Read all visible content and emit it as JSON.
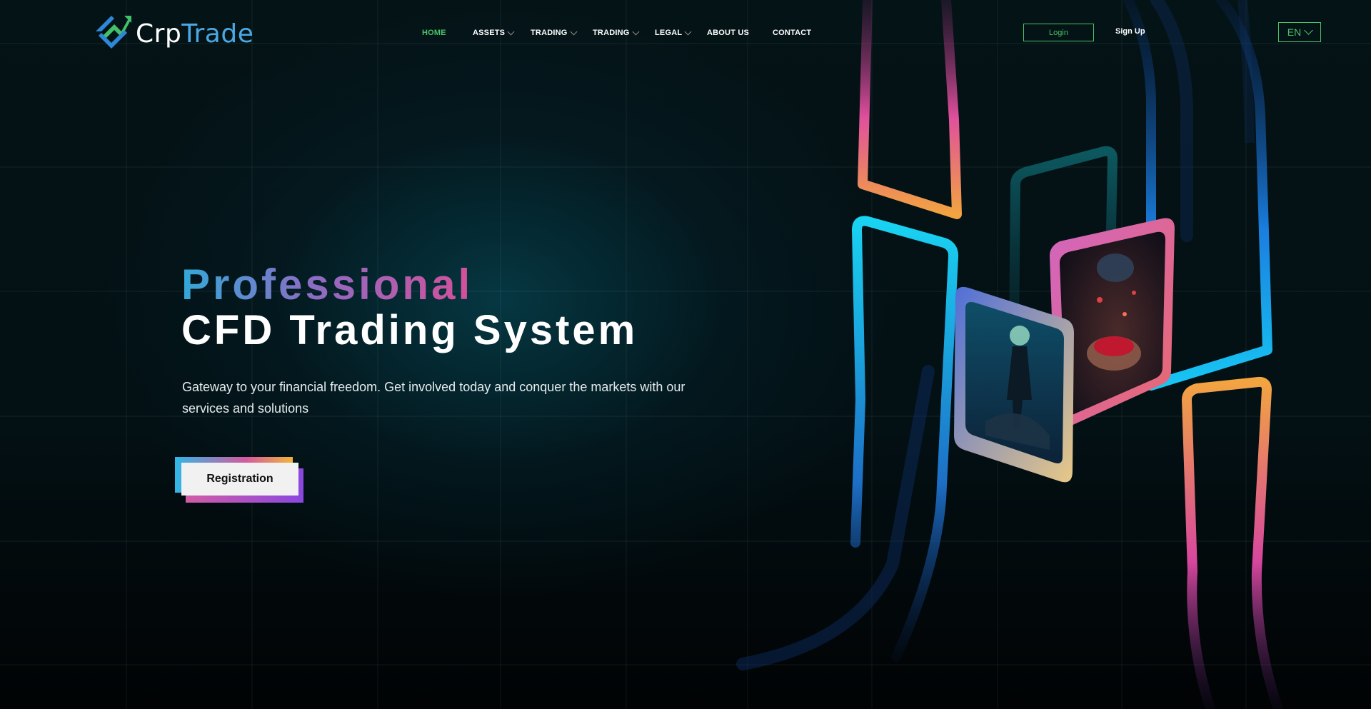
{
  "header": {
    "brand": {
      "part1": "Crp",
      "part2": "Trade"
    },
    "nav": [
      {
        "label": "HOME",
        "active": true,
        "dropdown": false
      },
      {
        "label": "ASSETS",
        "active": false,
        "dropdown": true
      },
      {
        "label": "TRADING",
        "active": false,
        "dropdown": true
      },
      {
        "label": "TRADING",
        "active": false,
        "dropdown": true
      },
      {
        "label": "LEGAL",
        "active": false,
        "dropdown": true
      },
      {
        "label": "ABOUT US",
        "active": false,
        "dropdown": false
      },
      {
        "label": "CONTACT",
        "active": false,
        "dropdown": false
      }
    ],
    "login_label": "Login",
    "signup_label": "Sign Up",
    "language": "EN"
  },
  "hero": {
    "title_line1": "Professional",
    "title_line2": "CFD Trading System",
    "subtitle": "Gateway to your financial freedom. Get involved today and conquer the markets with our services and solutions",
    "cta_label": "Registration"
  },
  "colors": {
    "accent_green": "#4cc267",
    "brand_blue": "#4aa8e4",
    "background": "#020709"
  },
  "icons": {
    "logo": "trend-arrow-logo-icon",
    "dropdown": "chevron-down-icon"
  }
}
